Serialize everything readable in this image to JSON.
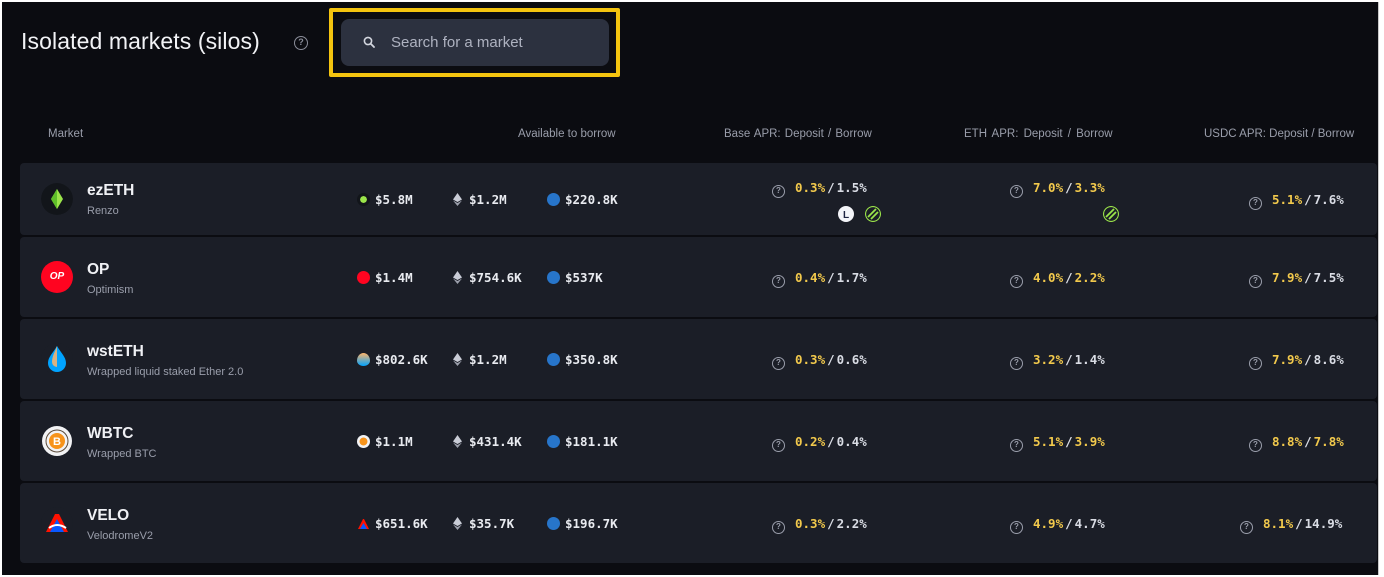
{
  "header": {
    "title": "Isolated markets (silos)",
    "help": "?"
  },
  "search": {
    "placeholder": "Search for a market",
    "value": ""
  },
  "columns": {
    "market": "Market",
    "available": "Available to borrow",
    "base_apr": "Base APR:  Deposit / Borrow",
    "eth_apr": "ETH APR:   Deposit / Borrow",
    "usdc_apr": "USDC APR: Deposit / Borrow"
  },
  "colors": {
    "highlight": "#f4c40f",
    "deposit": "#f2c94c",
    "row_bg": "#1b1e27",
    "page_bg": "#0b0c11"
  },
  "rows": [
    {
      "name": "ezETH",
      "sub": "Renzo",
      "icon": "ezeth-icon",
      "avail_token": "$5.8M",
      "avail_eth": "$1.2M",
      "avail_usdc": "$220.8K",
      "base": {
        "dep": "0.3%",
        "bor": "1.5%"
      },
      "eth": {
        "dep": "7.0%",
        "bor": "3.3%"
      },
      "usdc": {
        "dep": "5.1%",
        "bor": "7.6%"
      }
    },
    {
      "name": "OP",
      "sub": "Optimism",
      "icon": "op-icon",
      "icon_text": "OP",
      "avail_token": "$1.4M",
      "avail_eth": "$754.6K",
      "avail_usdc": "$537K",
      "base": {
        "dep": "0.4%",
        "bor": "1.7%"
      },
      "eth": {
        "dep": "4.0%",
        "bor": "2.2%"
      },
      "usdc": {
        "dep": "7.9%",
        "bor": "7.5%"
      }
    },
    {
      "name": "wstETH",
      "sub": "Wrapped liquid staked Ether 2.0",
      "icon": "wsteth-icon",
      "avail_token": "$802.6K",
      "avail_eth": "$1.2M",
      "avail_usdc": "$350.8K",
      "base": {
        "dep": "0.3%",
        "bor": "0.6%"
      },
      "eth": {
        "dep": "3.2%",
        "bor": "1.4%"
      },
      "usdc": {
        "dep": "7.9%",
        "bor": "8.6%"
      }
    },
    {
      "name": "WBTC",
      "sub": "Wrapped BTC",
      "icon": "wbtc-icon",
      "avail_token": "$1.1M",
      "avail_eth": "$431.4K",
      "avail_usdc": "$181.1K",
      "base": {
        "dep": "0.2%",
        "bor": "0.4%"
      },
      "eth": {
        "dep": "5.1%",
        "bor": "3.9%"
      },
      "usdc": {
        "dep": "8.8%",
        "bor": "7.8%"
      }
    },
    {
      "name": "VELO",
      "sub": "VelodromeV2",
      "icon": "velo-icon",
      "avail_token": "$651.6K",
      "avail_eth": "$35.7K",
      "avail_usdc": "$196.7K",
      "base": {
        "dep": "0.3%",
        "bor": "2.2%"
      },
      "eth": {
        "dep": "4.9%",
        "bor": "4.7%"
      },
      "usdc": {
        "dep": "8.1%",
        "bor": "14.9%"
      }
    }
  ]
}
